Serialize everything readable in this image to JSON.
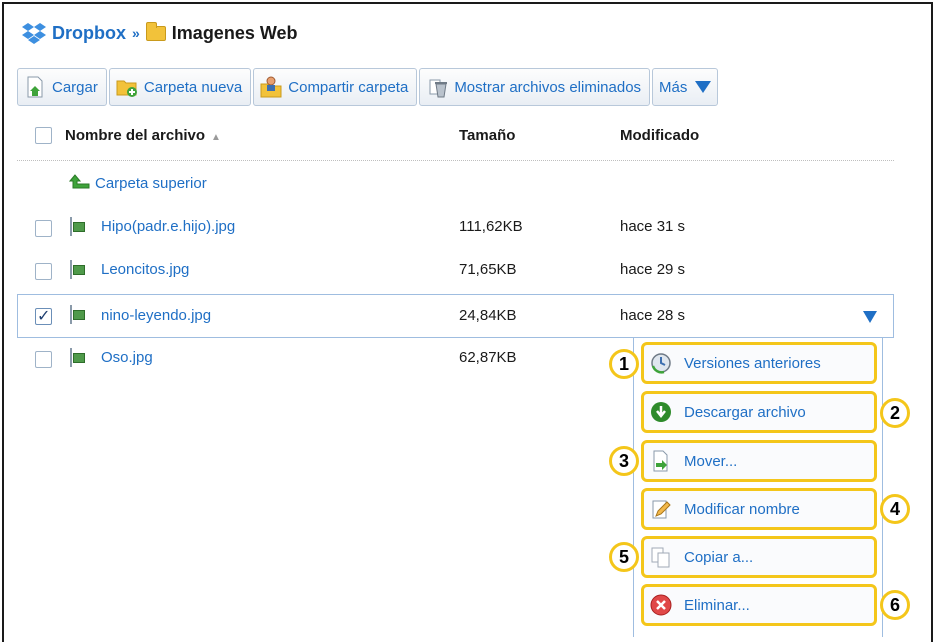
{
  "breadcrumb": {
    "root": "Dropbox",
    "separator": "»",
    "current": "Imagenes Web"
  },
  "toolbar": {
    "upload": "Cargar",
    "new_folder": "Carpeta nueva",
    "share_folder": "Compartir carpeta",
    "show_deleted": "Mostrar archivos eliminados",
    "more": "Más"
  },
  "columns": {
    "name": "Nombre del archivo",
    "sort_indicator": "▲",
    "size": "Tamaño",
    "modified": "Modificado"
  },
  "parent_folder": "Carpeta superior",
  "files": [
    {
      "name": "Hipo(padr.e.hijo).jpg",
      "size": "111,62KB",
      "modified": "hace 31 s",
      "checked": false
    },
    {
      "name": "Leoncitos.jpg",
      "size": "71,65KB",
      "modified": "hace 29 s",
      "checked": false
    },
    {
      "name": "nino-leyendo.jpg",
      "size": "24,84KB",
      "modified": "hace 28 s",
      "checked": true
    },
    {
      "name": "Oso.jpg",
      "size": "62,87KB",
      "modified": "",
      "checked": false
    }
  ],
  "context_menu": [
    {
      "label": "Versiones anteriores",
      "number": "1",
      "icon": "clock-icon"
    },
    {
      "label": "Descargar archivo",
      "number": "2",
      "icon": "download-icon"
    },
    {
      "label": "Mover...",
      "number": "3",
      "icon": "move-icon"
    },
    {
      "label": "Modificar nombre",
      "number": "4",
      "icon": "pencil-icon"
    },
    {
      "label": "Copiar a...",
      "number": "5",
      "icon": "copy-icon"
    },
    {
      "label": "Eliminar...",
      "number": "6",
      "icon": "delete-icon"
    }
  ],
  "colors": {
    "link": "#1f6fc5",
    "highlight": "#f4c61a",
    "folder": "#f2c23a"
  }
}
